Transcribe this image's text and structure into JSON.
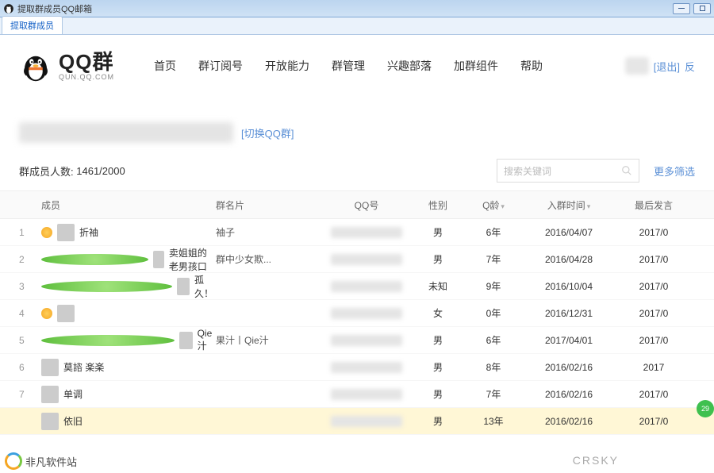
{
  "window": {
    "title": "提取群成员QQ邮箱"
  },
  "tab": {
    "label": "提取群成员"
  },
  "logo": {
    "big": "QQ群",
    "small": "QUN.QQ.COM"
  },
  "nav": [
    "首页",
    "群订阅号",
    "开放能力",
    "群管理",
    "兴趣部落",
    "加群组件",
    "帮助"
  ],
  "userbar": {
    "logout": "[退出]",
    "feedback": "反"
  },
  "group": {
    "switch": "[切换QQ群]"
  },
  "count": {
    "label": "群成员人数:",
    "value": "1461/2000"
  },
  "search": {
    "placeholder": "搜索关键词"
  },
  "filter": {
    "more": "更多筛选"
  },
  "columns": {
    "member": "成员",
    "card": "群名片",
    "qq": "QQ号",
    "gender": "性别",
    "age": "Q龄",
    "join": "入群时间",
    "last": "最后发言"
  },
  "rows": [
    {
      "idx": "1",
      "badge": "admin",
      "name": "折袖",
      "card": "袖子",
      "gender": "男",
      "age": "6年",
      "join": "2016/04/07",
      "last": "2017/0"
    },
    {
      "idx": "2",
      "badge": "member",
      "name": "卖姐姐的老男孩口",
      "card": "群中少女欺...",
      "gender": "男",
      "age": "7年",
      "join": "2016/04/28",
      "last": "2017/0"
    },
    {
      "idx": "3",
      "badge": "member",
      "name": "孤久！",
      "card": "",
      "gender": "未知",
      "age": "9年",
      "join": "2016/10/04",
      "last": "2017/0"
    },
    {
      "idx": "4",
      "badge": "admin",
      "name": "",
      "card": "",
      "gender": "女",
      "age": "0年",
      "join": "2016/12/31",
      "last": "2017/0"
    },
    {
      "idx": "5",
      "badge": "member",
      "name": "Qie汁",
      "card": "果汁丨Qie汁",
      "gender": "男",
      "age": "6年",
      "join": "2017/04/01",
      "last": "2017/0"
    },
    {
      "idx": "6",
      "badge": "",
      "name": "莫諮 楽楽",
      "card": "",
      "gender": "男",
      "age": "8年",
      "join": "2016/02/16",
      "last": "2017"
    },
    {
      "idx": "7",
      "badge": "",
      "name": "单调",
      "card": "",
      "gender": "男",
      "age": "7年",
      "join": "2016/02/16",
      "last": "2017/0"
    },
    {
      "idx": "",
      "badge": "",
      "name": "依旧",
      "card": "",
      "gender": "男",
      "age": "13年",
      "join": "2016/02/16",
      "last": "2017/0",
      "highlight": true
    }
  ],
  "watermark": {
    "site": "非凡软件站",
    "crsky": "CRSKY"
  },
  "greenbadge": "29"
}
